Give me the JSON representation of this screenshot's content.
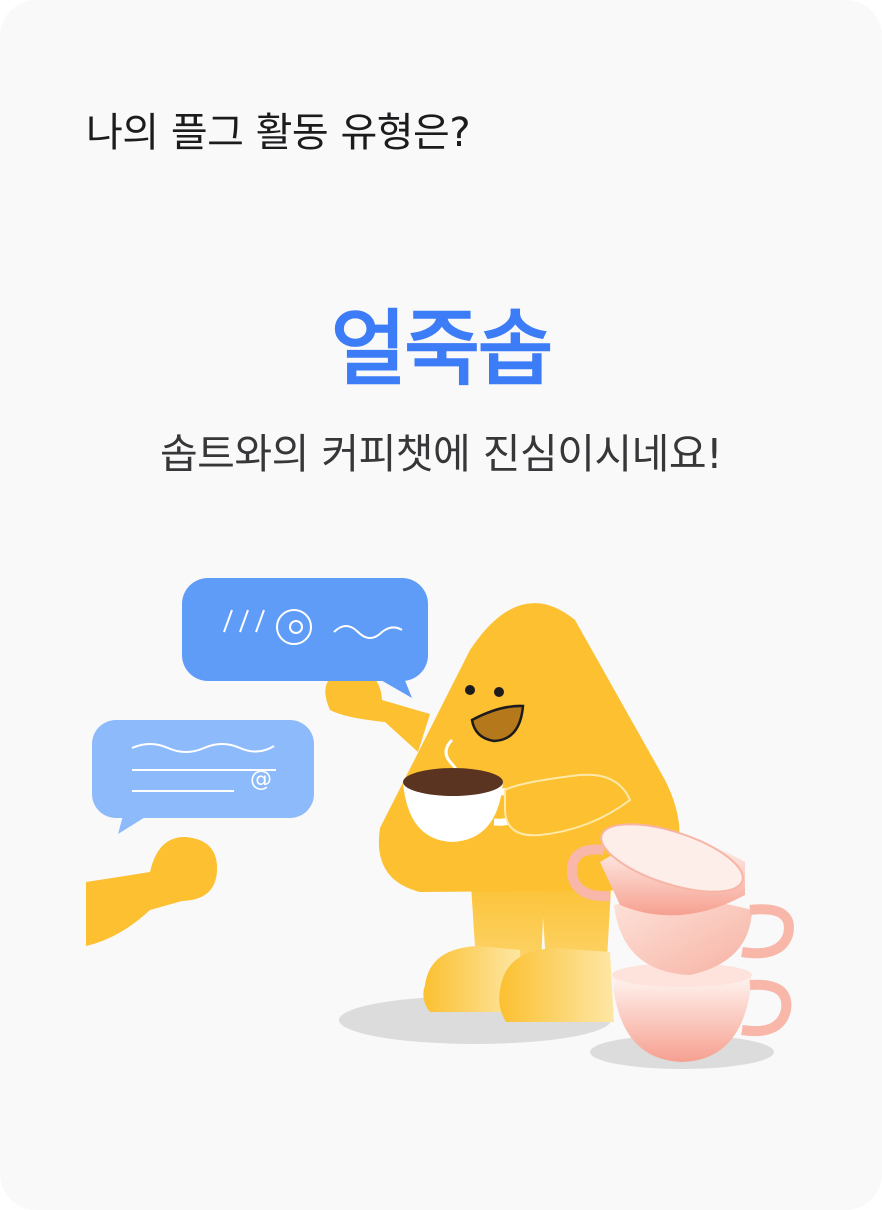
{
  "header": {
    "question": "나의 플그 활동 유형은?"
  },
  "result": {
    "type_name": "얼죽솝",
    "description": "솝트와의 커피챗에 진심이시네요!"
  },
  "illustration": {
    "bubble_top_text": "///@~~",
    "bubble_left_symbol": "@",
    "colors": {
      "accent_blue": "#3d7cf7",
      "bubble_blue": "#5f9cf7",
      "bubble_light_blue": "#8dbafb",
      "character_yellow": "#fcc030",
      "cup_pink": "#f6a99a",
      "shadow_gray": "#dcdcdc"
    }
  }
}
